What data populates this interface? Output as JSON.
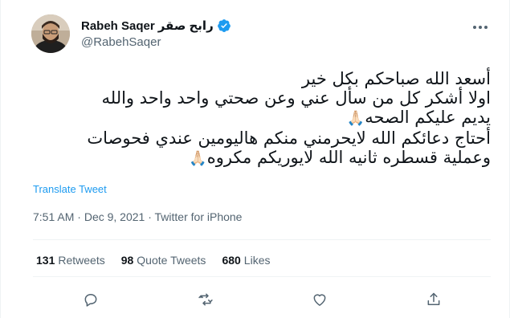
{
  "author": {
    "display_name_latin": "Rabeh Saqer",
    "display_name_arabic": "رابح صقر",
    "handle": "@RabehSaqer",
    "verified": true
  },
  "tweet": {
    "lines": [
      "أسعد الله صباحكم بكل خير",
      "اولا أشكر كل من سأل عني وعن صحتي واحد واحد والله",
      "يديم عليكم الصحه",
      "أحتاج دعائكم الله لايحرمني منكم هاليومين عندي فحوصات",
      "وعملية قسطره ثانيه الله لايوريكم مكروه"
    ],
    "emoji": "🙏🏻",
    "translate_label": "Translate Tweet",
    "time": "7:51 AM",
    "date": "Dec 9, 2021",
    "source": "Twitter for iPhone",
    "separator": "·"
  },
  "stats": {
    "retweets": {
      "count": "131",
      "label": "Retweets"
    },
    "quote_tweets": {
      "count": "98",
      "label": "Quote Tweets"
    },
    "likes": {
      "count": "680",
      "label": "Likes"
    }
  },
  "colors": {
    "accent": "#1d9bf0",
    "secondary_text": "#536471",
    "primary_text": "#0f1419",
    "divider": "#eff3f4"
  },
  "icons": {
    "reply": "reply-icon",
    "retweet": "retweet-icon",
    "like": "heart-icon",
    "share": "share-icon",
    "more": "more-icon",
    "verified": "verified-badge-icon"
  }
}
